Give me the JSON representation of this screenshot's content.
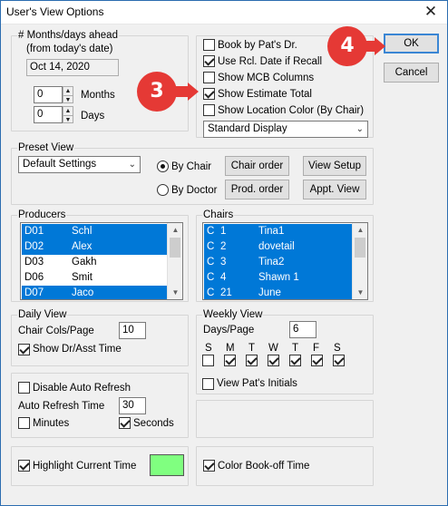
{
  "window": {
    "title": "User's View Options",
    "close_glyph": "✕"
  },
  "annotations": {
    "marker_3": "3",
    "marker_4": "4",
    "marker_color": "#e53935"
  },
  "months_days": {
    "group_label": "# Months/days ahead",
    "subtitle": "(from today's date)",
    "date_value": "Oct 14, 2020",
    "months_value": "0",
    "months_label": "Months",
    "days_value": "0",
    "days_label": "Days"
  },
  "options": {
    "book_by_dr": {
      "label": "Book by Pat's Dr.",
      "checked": false
    },
    "use_rcl_date": {
      "label": "Use Rcl. Date if Recall",
      "checked": true
    },
    "show_mcb": {
      "label": "Show MCB Columns",
      "checked": false
    },
    "show_estimate": {
      "label": "Show Estimate Total",
      "checked": true
    },
    "show_location_color": {
      "label": "Show Location Color (By Chair)",
      "checked": false
    },
    "display_select": "Standard Display"
  },
  "buttons": {
    "ok": "OK",
    "cancel": "Cancel"
  },
  "preset": {
    "group_label": "Preset View",
    "select_value": "Default Settings",
    "by_chair": "By Chair",
    "by_doctor": "By Doctor",
    "by_chair_selected": true,
    "chair_order": "Chair order",
    "view_setup": "View Setup",
    "prod_order": "Prod. order",
    "appt_view": "Appt. View"
  },
  "producers": {
    "group_label": "Producers",
    "rows": [
      {
        "code": "D01",
        "name": "Schl",
        "selected": true
      },
      {
        "code": "D02",
        "name": "Alex",
        "selected": true
      },
      {
        "code": "D03",
        "name": "Gakh",
        "selected": false
      },
      {
        "code": "D06",
        "name": "Smit",
        "selected": false
      },
      {
        "code": "D07",
        "name": "Jaco",
        "selected": true
      }
    ]
  },
  "chairs": {
    "group_label": "Chairs",
    "rows": [
      {
        "prefix": "C",
        "num": "1",
        "name": "Tina1",
        "selected": true
      },
      {
        "prefix": "C",
        "num": "2",
        "name": "dovetail",
        "selected": true
      },
      {
        "prefix": "C",
        "num": "3",
        "name": "Tina2",
        "selected": true
      },
      {
        "prefix": "C",
        "num": "4",
        "name": "Shawn 1",
        "selected": true
      },
      {
        "prefix": "C",
        "num": "21",
        "name": "June",
        "selected": true
      }
    ]
  },
  "daily": {
    "group_label": "Daily View",
    "chair_cols_label": "Chair Cols/Page",
    "chair_cols_value": "10",
    "show_dr_asst": {
      "label": "Show Dr/Asst Time",
      "checked": true
    }
  },
  "weekly": {
    "group_label": "Weekly View",
    "days_page_label": "Days/Page",
    "days_page_value": "6",
    "days": [
      {
        "label": "S",
        "checked": false
      },
      {
        "label": "M",
        "checked": true
      },
      {
        "label": "T",
        "checked": true
      },
      {
        "label": "W",
        "checked": true
      },
      {
        "label": "T",
        "checked": true
      },
      {
        "label": "F",
        "checked": true
      },
      {
        "label": "S",
        "checked": true
      }
    ],
    "view_initials": {
      "label": "View Pat's Initials",
      "checked": false
    }
  },
  "refresh": {
    "disable_auto": {
      "label": "Disable Auto Refresh",
      "checked": false
    },
    "time_label": "Auto Refresh Time",
    "time_value": "30",
    "minutes": {
      "label": "Minutes",
      "checked": false
    },
    "seconds": {
      "label": "Seconds",
      "checked": true
    }
  },
  "highlight": {
    "label": "Highlight Current Time",
    "checked": true,
    "color": "#80ff80"
  },
  "bookoff": {
    "label": "Color Book-off Time",
    "checked": true
  }
}
